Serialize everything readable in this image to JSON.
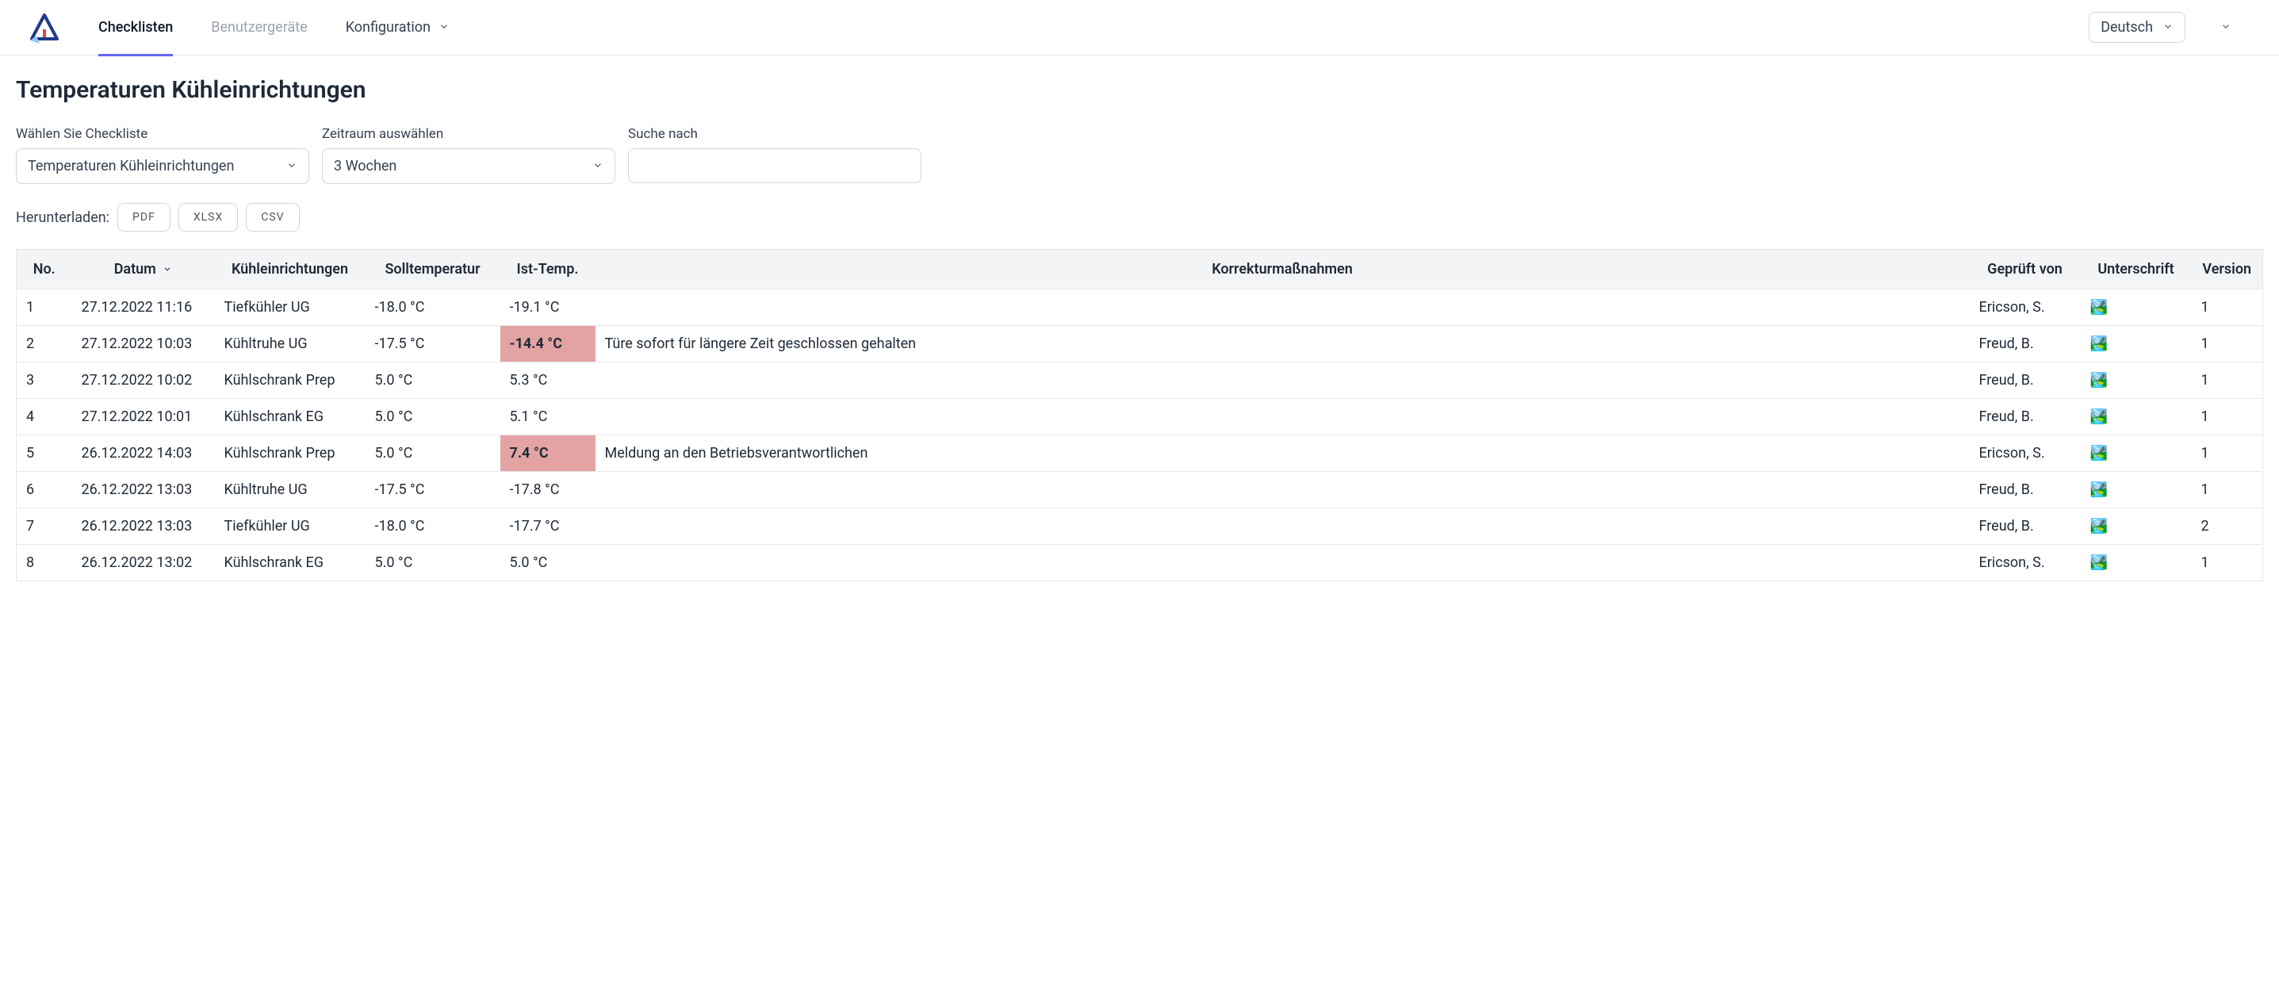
{
  "nav": {
    "checklisten": "Checklisten",
    "benutzergeraete": "Benutzergeräte",
    "konfiguration": "Konfiguration"
  },
  "language": {
    "current": "Deutsch"
  },
  "page": {
    "title": "Temperaturen Kühleinrichtungen"
  },
  "filters": {
    "checklist": {
      "label": "Wählen Sie Checkliste",
      "value": "Temperaturen Kühleinrichtungen"
    },
    "period": {
      "label": "Zeitraum auswählen",
      "value": "3 Wochen"
    },
    "search": {
      "label": "Suche nach",
      "value": ""
    }
  },
  "download": {
    "label": "Herunterladen:",
    "pdf": "PDF",
    "xlsx": "XLSX",
    "csv": "CSV"
  },
  "table": {
    "headers": {
      "no": "No.",
      "datum": "Datum",
      "device": "Kühleinrichtungen",
      "soll": "Solltemperatur",
      "ist": "Ist-Temp.",
      "korrektur": "Korrekturmaßnahmen",
      "geprueft": "Geprüft von",
      "unterschrift": "Unterschrift",
      "version": "Version"
    },
    "rows": [
      {
        "no": "1",
        "datum": "27.12.2022 11:16",
        "device": "Tiefkühler UG",
        "soll": "-18.0 °C",
        "ist": "-19.1 °C",
        "ist_alert": false,
        "korrektur": "",
        "geprueft": "Ericson, S.",
        "version": "1"
      },
      {
        "no": "2",
        "datum": "27.12.2022 10:03",
        "device": "Kühltruhe UG",
        "soll": "-17.5 °C",
        "ist": "-14.4 °C",
        "ist_alert": true,
        "korrektur": "Türe sofort für längere Zeit geschlossen gehalten",
        "geprueft": "Freud, B.",
        "version": "1"
      },
      {
        "no": "3",
        "datum": "27.12.2022 10:02",
        "device": "Kühlschrank Prep",
        "soll": "5.0 °C",
        "ist": "5.3 °C",
        "ist_alert": false,
        "korrektur": "",
        "geprueft": "Freud, B.",
        "version": "1"
      },
      {
        "no": "4",
        "datum": "27.12.2022 10:01",
        "device": "Kühlschrank EG",
        "soll": "5.0 °C",
        "ist": "5.1 °C",
        "ist_alert": false,
        "korrektur": "",
        "geprueft": "Freud, B.",
        "version": "1"
      },
      {
        "no": "5",
        "datum": "26.12.2022 14:03",
        "device": "Kühlschrank Prep",
        "soll": "5.0 °C",
        "ist": "7.4 °C",
        "ist_alert": true,
        "korrektur": "Meldung an den Betriebsverantwortlichen",
        "geprueft": "Ericson, S.",
        "version": "1"
      },
      {
        "no": "6",
        "datum": "26.12.2022 13:03",
        "device": "Kühltruhe UG",
        "soll": "-17.5 °C",
        "ist": "-17.8 °C",
        "ist_alert": false,
        "korrektur": "",
        "geprueft": "Freud, B.",
        "version": "1"
      },
      {
        "no": "7",
        "datum": "26.12.2022 13:03",
        "device": "Tiefkühler UG",
        "soll": "-18.0 °C",
        "ist": "-17.7 °C",
        "ist_alert": false,
        "korrektur": "",
        "geprueft": "Freud, B.",
        "version": "2"
      },
      {
        "no": "8",
        "datum": "26.12.2022 13:02",
        "device": "Kühlschrank EG",
        "soll": "5.0 °C",
        "ist": "5.0 °C",
        "ist_alert": false,
        "korrektur": "",
        "geprueft": "Ericson, S.",
        "version": "1"
      }
    ]
  }
}
